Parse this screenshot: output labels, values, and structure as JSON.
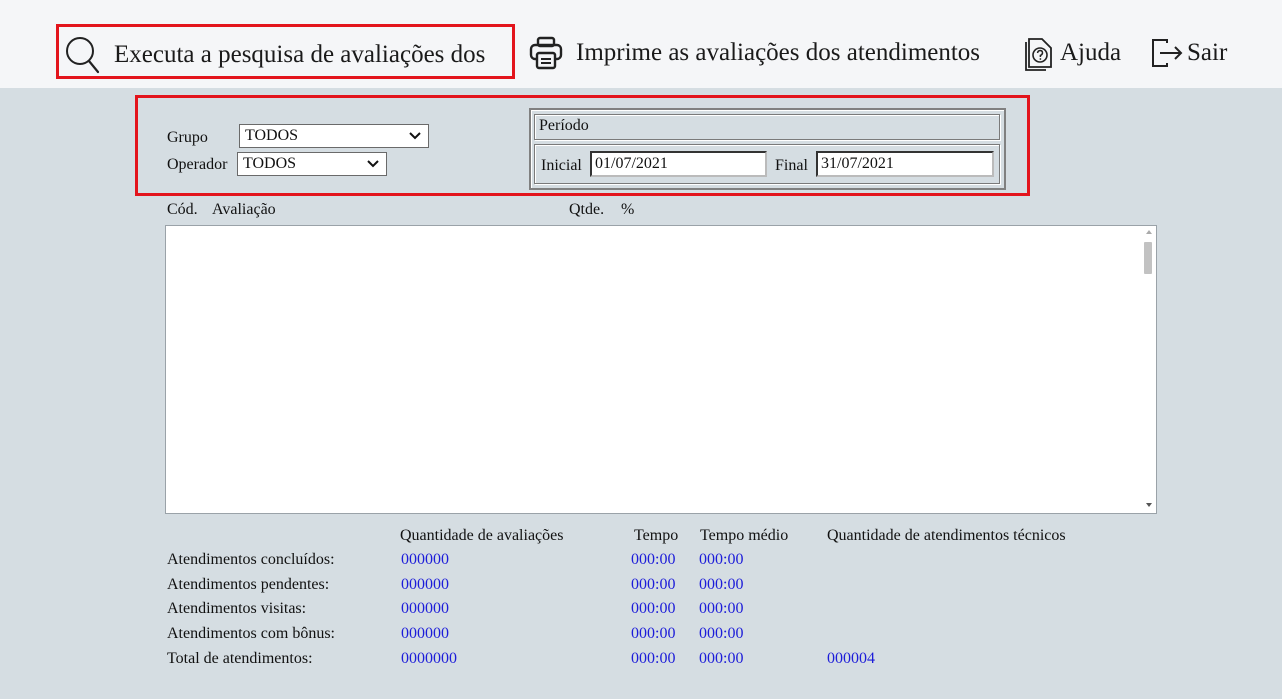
{
  "toolbar": {
    "search_label": "Executa a pesquisa de avaliações dos",
    "print_label": "Imprime as avaliações dos atendimentos",
    "help_label": "Ajuda",
    "exit_label": "Sair",
    "icons": [
      "search-icon",
      "printer-icon",
      "help-icon",
      "exit-icon"
    ]
  },
  "filters": {
    "grupo_label": "Grupo",
    "grupo_value": "TODOS",
    "operador_label": "Operador",
    "operador_value": "TODOS",
    "periodo_label": "Período",
    "inicial_label": "Inicial",
    "inicial_value": "01/07/2021",
    "final_label": "Final",
    "final_value": "31/07/2021"
  },
  "list": {
    "headers": [
      "Cód.",
      "Avaliação",
      "Qtde.",
      "%"
    ],
    "rows": []
  },
  "summary": {
    "columns": [
      "Quantidade de avaliações",
      "Tempo",
      "Tempo médio",
      "Quantidade de atendimentos técnicos"
    ],
    "rows": [
      {
        "label": "Atendimentos concluídos:",
        "qtd": "000000",
        "tempo": "000:00",
        "medio": "000:00",
        "tecnicos": ""
      },
      {
        "label": "Atendimentos pendentes:",
        "qtd": "000000",
        "tempo": "000:00",
        "medio": "000:00",
        "tecnicos": ""
      },
      {
        "label": "Atendimentos visitas:",
        "qtd": "000000",
        "tempo": "000:00",
        "medio": "000:00",
        "tecnicos": ""
      },
      {
        "label": "Atendimentos com bônus:",
        "qtd": "000000",
        "tempo": "000:00",
        "medio": "000:00",
        "tecnicos": ""
      },
      {
        "label": "Total de atendimentos:",
        "qtd": "0000000",
        "tempo": "000:00",
        "medio": "000:00",
        "tecnicos": "000004"
      }
    ]
  },
  "colors": {
    "highlight": "#e3141c",
    "panel_bg": "#d5dde2",
    "value_blue": "#1c1cd9"
  }
}
